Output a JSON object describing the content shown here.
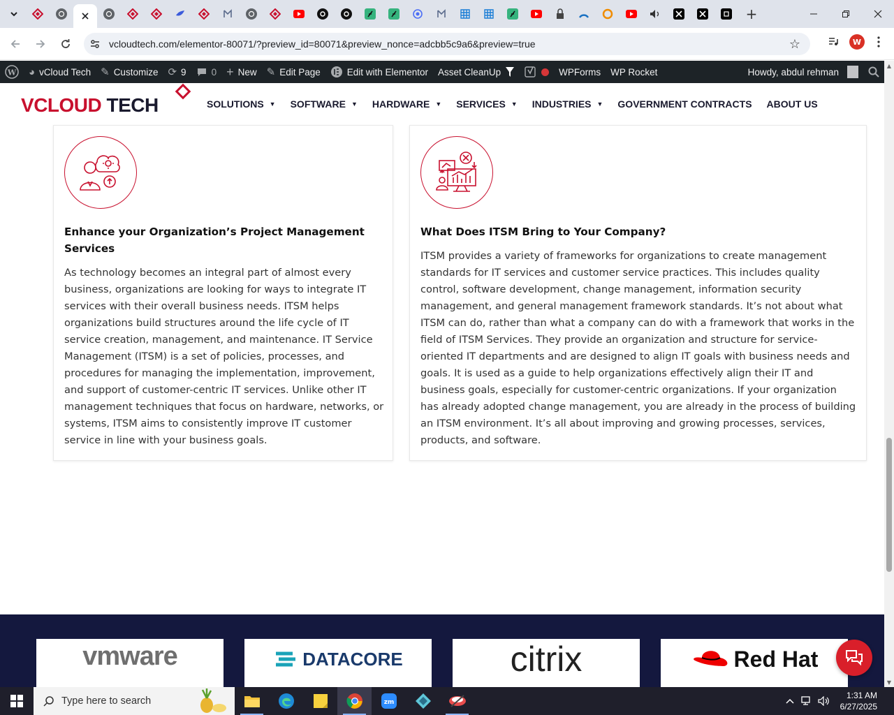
{
  "browser": {
    "tabs": [
      {
        "icon": "diamond-favicon-icon",
        "color": "#c8102e"
      },
      {
        "icon": "globe-favicon-icon",
        "color": "#5f6368"
      },
      {
        "icon": "close-tab-icon",
        "color": "#202124"
      },
      {
        "icon": "globe-favicon-icon",
        "color": "#5f6368"
      },
      {
        "icon": "diamond-favicon-icon",
        "color": "#c8102e"
      },
      {
        "icon": "diamond-favicon-icon",
        "color": "#c8102e"
      },
      {
        "icon": "bird-favicon-icon",
        "color": "#3b5bdb"
      },
      {
        "icon": "diamond-favicon-icon",
        "color": "#c8102e"
      },
      {
        "icon": "ai-favicon-icon",
        "color": "#5b6b8c"
      },
      {
        "icon": "globe-favicon-icon",
        "color": "#5f6368"
      },
      {
        "icon": "diamond-favicon-icon",
        "color": "#c8102e"
      },
      {
        "icon": "youtube-favicon-icon",
        "color": "#ff0000"
      },
      {
        "icon": "openai-favicon-icon",
        "color": "#111111"
      },
      {
        "icon": "openai-favicon-icon",
        "color": "#111111"
      },
      {
        "icon": "green-leaf-favicon-icon",
        "color": "#36b37e"
      },
      {
        "icon": "green-leaf-favicon-icon",
        "color": "#36b37e"
      },
      {
        "icon": "spiral-favicon-icon",
        "color": "#4c6ef5"
      },
      {
        "icon": "ai-favicon-icon",
        "color": "#5b6b8c"
      },
      {
        "icon": "grid-favicon-icon",
        "color": "#1c7ed6"
      },
      {
        "icon": "grid-favicon-icon",
        "color": "#1c7ed6"
      },
      {
        "icon": "green-leaf-favicon-icon",
        "color": "#36b37e"
      },
      {
        "icon": "youtube-favicon-icon",
        "color": "#ff0000"
      },
      {
        "icon": "lock-favicon-icon",
        "color": "#444444"
      },
      {
        "icon": "arc-favicon-icon",
        "color": "#1971c2"
      },
      {
        "icon": "ring-favicon-icon",
        "color": "#f08c00"
      },
      {
        "icon": "youtube-favicon-icon",
        "color": "#ff0000"
      },
      {
        "icon": "speaker-favicon-icon",
        "color": "#333333"
      },
      {
        "icon": "x-favicon-icon",
        "color": "#000000"
      },
      {
        "icon": "x-favicon-icon",
        "color": "#000000"
      },
      {
        "icon": "square-favicon-icon",
        "color": "#000000"
      }
    ],
    "url": "vcloudtech.com/elementor-80071/?preview_id=80071&preview_nonce=adcbb5c9a6&preview=true",
    "profile_initial": "W"
  },
  "adminbar": {
    "site_name": "vCloud Tech",
    "customize": "Customize",
    "updates_count": "9",
    "comments_count": "0",
    "new": "New",
    "edit_page": "Edit Page",
    "edit_elementor": "Edit with Elementor",
    "asset_cleanup": "Asset CleanUp",
    "wpforms": "WPForms",
    "wp_rocket": "WP Rocket",
    "howdy": "Howdy, abdul rehman"
  },
  "site": {
    "logo_v": "V",
    "logo_cloud": "CLOUD ",
    "logo_tech": "TECH",
    "nav": [
      {
        "label": "SOLUTIONS",
        "dropdown": true
      },
      {
        "label": "SOFTWARE",
        "dropdown": true
      },
      {
        "label": "HARDWARE",
        "dropdown": true
      },
      {
        "label": "SERVICES",
        "dropdown": true
      },
      {
        "label": "INDUSTRIES",
        "dropdown": true
      },
      {
        "label": "GOVERNMENT CONTRACTS",
        "dropdown": false
      },
      {
        "label": "ABOUT US",
        "dropdown": false
      }
    ]
  },
  "cards": [
    {
      "title": "Enhance your Organization’s Project Management Services",
      "body": "As technology becomes an integral part of almost every business, organizations are looking for ways to integrate IT services with their overall business needs. ITSM helps organizations build structures around the life cycle of IT service creation, management, and maintenance. IT Service Management (ITSM) is a set of policies, processes, and procedures for managing the implementation, improvement, and support of customer-centric IT services. Unlike other IT management techniques that focus on hardware, networks, or systems, ITSM aims to consistently improve IT customer service in line with your business goals.",
      "icon": "person-gear-cloud-icon"
    },
    {
      "title": "What Does ITSM Bring to Your Company?",
      "body": "ITSM provides a variety of frameworks for organizations to create management standards for IT services and customer service practices. This includes quality control, software development, change management, information security management, and general management framework standards. It’s not about what ITSM can do, rather than what a company can do with a framework that works in the field of ITSM Services. They provide an organization and structure for service-oriented IT departments and are designed to align IT goals with business needs and goals. It is used as a guide to help organizations effectively align their IT and business goals, especially for customer-centric organizations. If your organization has already adopted change management, you are already in the process of building an ITSM environment. It’s all about improving and growing processes, services, products, and software.",
      "icon": "analytics-dashboard-icon"
    }
  ],
  "partners": [
    "vmware",
    "DATACORE",
    "citrix",
    "Red Hat"
  ],
  "colors": {
    "brand_red": "#c8102e",
    "navy": "#14183e",
    "admin_bar": "#1d2327"
  },
  "taskbar": {
    "search_placeholder": "Type here to search",
    "time": "1:31 AM",
    "date": "6/27/2025"
  }
}
